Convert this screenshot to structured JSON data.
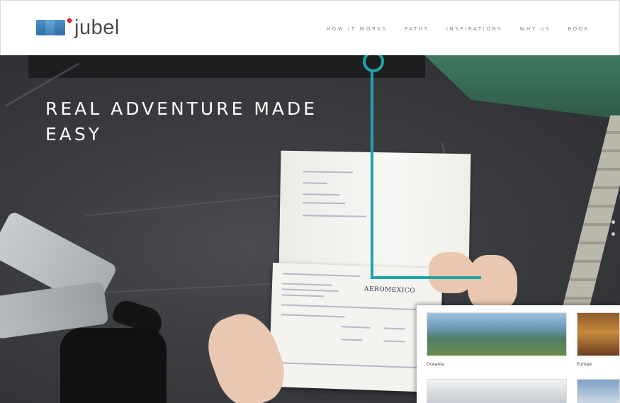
{
  "brand": {
    "logo_text": "jubel",
    "logo_colors": {
      "blue": "#3a7bb8",
      "red": "#d9262b"
    }
  },
  "nav": {
    "items": [
      {
        "label": "HOW IT WORKS"
      },
      {
        "label": "PATHS"
      },
      {
        "label": "INSPIRATIONS"
      },
      {
        "label": "WHY US"
      },
      {
        "label": "BOOK"
      }
    ]
  },
  "hero": {
    "headline": "REAL ADVENTURE MADE\nEASY"
  },
  "ticket": {
    "airline": "AEROMEXICO"
  },
  "inset": {
    "cards": [
      {
        "caption": "Oceania"
      },
      {
        "caption": "Europe"
      }
    ]
  },
  "colors": {
    "accent": "#1fa3a9",
    "nav_text": "#7a8a94",
    "hero_text": "#ffffff"
  },
  "icons": {
    "annotation": "teal-callout-marker",
    "slider": "slider-dots"
  }
}
